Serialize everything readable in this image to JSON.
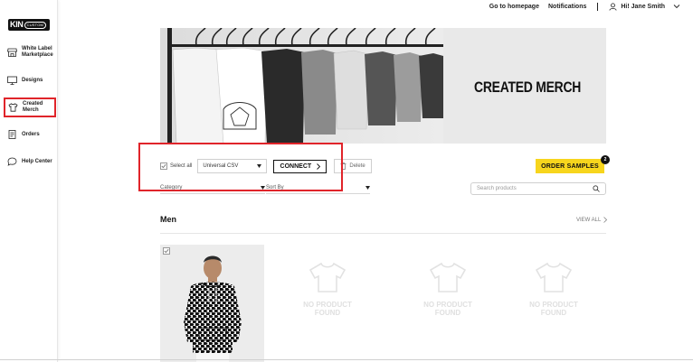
{
  "topbar": {
    "homepage_label": "Go to homepage",
    "notifications_label": "Notifications",
    "user_label": "Hi! Jane Smith"
  },
  "sidebar": {
    "logo_big": "KIN",
    "logo_small": "CUSTOM",
    "items": [
      {
        "label": "White Label Marketplace",
        "icon": "storefront-icon"
      },
      {
        "label": "Designs",
        "icon": "monitor-icon"
      },
      {
        "label": "Created Merch",
        "icon": "tshirt-icon"
      },
      {
        "label": "Orders",
        "icon": "receipt-icon"
      },
      {
        "label": "Help Center",
        "icon": "chat-icon"
      }
    ],
    "active_item": "Created Merch"
  },
  "banner": {
    "title": "CREATED MERCH"
  },
  "toolbar": {
    "select_all_label": "Select all",
    "export_format": "Universal CSV",
    "connect_label": "CONNECT",
    "delete_label": "Delete",
    "order_samples_label": "ORDER SAMPLES",
    "order_samples_count": "2"
  },
  "filters": {
    "category_label": "Category",
    "sort_label": "Sort By",
    "search_placeholder": "Search products"
  },
  "section": {
    "title": "Men",
    "view_all_label": "VIEW ALL"
  },
  "products": {
    "placeholder_line1": "NO PRODUCT",
    "placeholder_line2": "FOUND"
  },
  "colors": {
    "accent_yellow": "#f7d51d",
    "highlight_red": "#e0242a"
  }
}
